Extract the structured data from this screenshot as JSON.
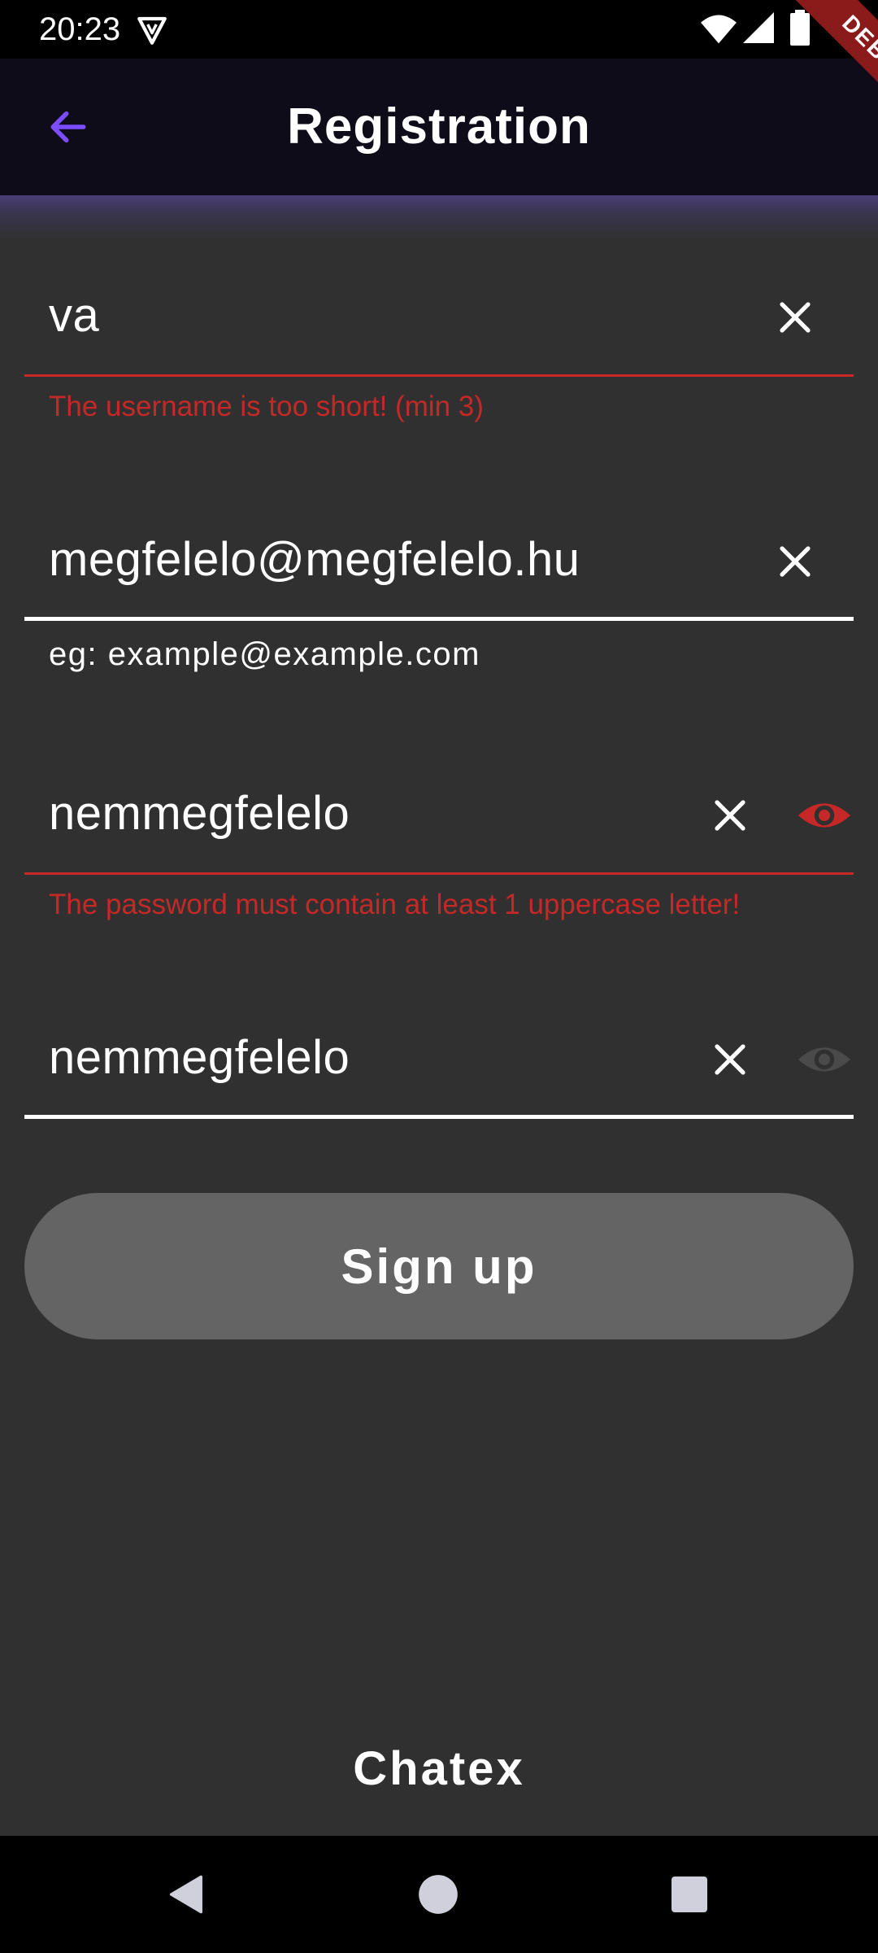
{
  "status_bar": {
    "time": "20:23"
  },
  "debug_banner": {
    "label": "DEBUG"
  },
  "app_bar": {
    "title": "Registration",
    "accent_color": "#7c4dff"
  },
  "form": {
    "username": {
      "value": "va",
      "error": "The username is too short! (min 3)"
    },
    "email": {
      "value": "megfelelo@megfelelo.hu",
      "hint": "eg: example@example.com"
    },
    "password": {
      "value": "nemmegfelelo",
      "error": "The password must contain at least 1 uppercase letter!",
      "visibility_icon_color": "#c62828"
    },
    "confirm_password": {
      "value": "nemmegfelelo",
      "visibility_icon_color": "#4a4a4a"
    },
    "error_color": "#c62828"
  },
  "actions": {
    "signup_label": "Sign up"
  },
  "footer": {
    "brand": "Chatex"
  }
}
